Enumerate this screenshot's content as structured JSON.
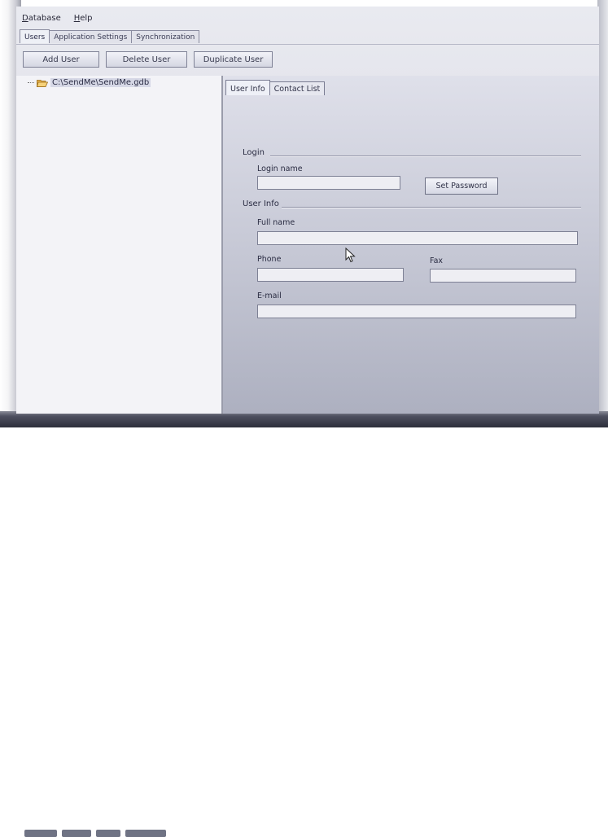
{
  "menu": [
    {
      "label": "Database",
      "ul": "D",
      "rest": "atabase"
    },
    {
      "label": "Help",
      "ul": "H",
      "rest": "elp"
    }
  ],
  "top_tabs": [
    "Users",
    "Application Settings",
    "Synchronization"
  ],
  "toolbar": {
    "add_user": "Add User",
    "delete_user": "Delete User",
    "duplicate_user": "Duplicate User"
  },
  "tree": {
    "root_label": "C:\\SendMe\\SendMe.gdb"
  },
  "detail_tabs": [
    "User Info",
    "Contact List"
  ],
  "login_section": {
    "title": "Login",
    "login_name_label": "Login name",
    "login_name_value": "",
    "set_password": "Set Password"
  },
  "user_info_section": {
    "title": "User Info",
    "full_name_label": "Full name",
    "full_name_value": "",
    "phone_label": "Phone",
    "phone_value": "",
    "fax_label": "Fax",
    "fax_value": "",
    "email_label": "E-mail",
    "email_value": ""
  },
  "icons": {
    "tree_root": "folder-open-icon",
    "pointer": "mouse-cursor-icon"
  }
}
